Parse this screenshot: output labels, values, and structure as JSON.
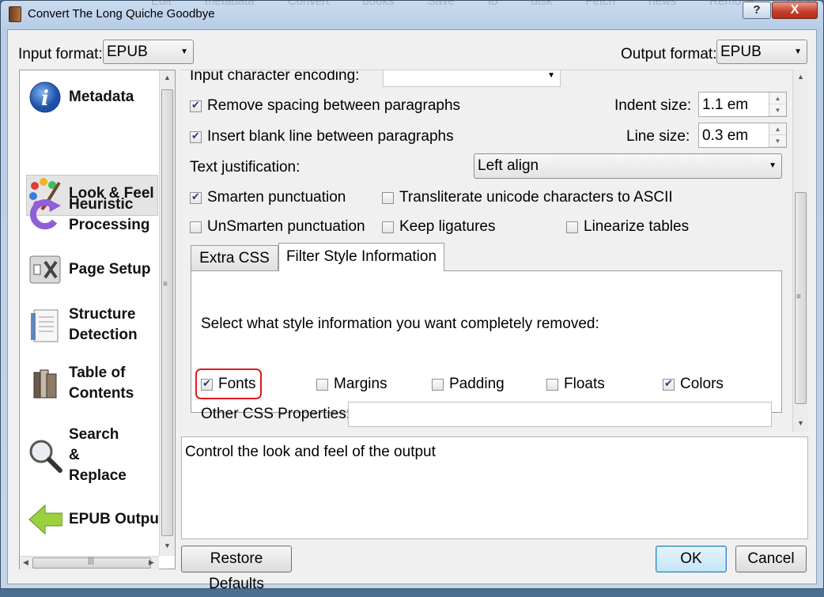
{
  "window": {
    "title": "Convert The Long Quiche Goodbye",
    "ghost_menu": "Edit metadata  Convert books  Save to disk  Fetch news  Remove books  Preferences  Help",
    "help_glyph": "?",
    "close_glyph": "X"
  },
  "formats": {
    "input_label": "Input format:",
    "input_value": "EPUB",
    "output_label": "Output format:",
    "output_value": "EPUB"
  },
  "sidebar": {
    "items": [
      {
        "label": "Metadata",
        "icon": "info-icon"
      },
      {
        "label": "Look & Feel",
        "icon": "palette-icon"
      },
      {
        "label": "Heuristic\nProcessing",
        "icon": "heuristic-arrow-icon"
      },
      {
        "label": "Page Setup",
        "icon": "page-setup-icon"
      },
      {
        "label": "Structure\nDetection",
        "icon": "document-icon"
      },
      {
        "label": "Table of\nContents",
        "icon": "books-icon"
      },
      {
        "label": "Search\n&\nReplace",
        "icon": "magnifier-icon"
      },
      {
        "label": "EPUB Output",
        "icon": "green-arrow-icon"
      }
    ],
    "selected_index": 1
  },
  "look_feel": {
    "encoding_label": "Input character encoding:",
    "encoding_value": "",
    "remove_spacing": {
      "label": "Remove spacing between paragraphs",
      "checked": true
    },
    "indent_label": "Indent size:",
    "indent_value": "1.1 em",
    "insert_blank": {
      "label": "Insert blank line between paragraphs",
      "checked": true
    },
    "line_label": "Line size:",
    "line_value": "0.3 em",
    "justification_label": "Text justification:",
    "justification_value": "Left align",
    "smarten": {
      "label": "Smarten punctuation",
      "checked": true
    },
    "transliterate": {
      "label": "Transliterate unicode characters to ASCII",
      "checked": false
    },
    "unsmarten": {
      "label": "UnSmarten punctuation",
      "checked": false
    },
    "keep_ligatures": {
      "label": "Keep ligatures",
      "checked": false
    },
    "linearize_tables": {
      "label": "Linearize tables",
      "checked": false
    }
  },
  "tabs": {
    "extra_css": "Extra CSS",
    "filter_style": "Filter Style Information",
    "active": "filter_style"
  },
  "filter": {
    "description": "Select what style information you want completely removed:",
    "fonts": {
      "label": "Fonts",
      "checked": true
    },
    "margins": {
      "label": "Margins",
      "checked": false
    },
    "padding": {
      "label": "Padding",
      "checked": false
    },
    "floats": {
      "label": "Floats",
      "checked": false
    },
    "colors": {
      "label": "Colors",
      "checked": true
    },
    "other_label": "Other CSS Properties:",
    "other_value": ""
  },
  "help_text": "Control the look and feel of the output",
  "buttons": {
    "restore": "Restore Defaults",
    "ok": "OK",
    "cancel": "Cancel"
  },
  "colors": {
    "highlight_red": "#e0191f",
    "ok_border": "#3c7fb1"
  }
}
